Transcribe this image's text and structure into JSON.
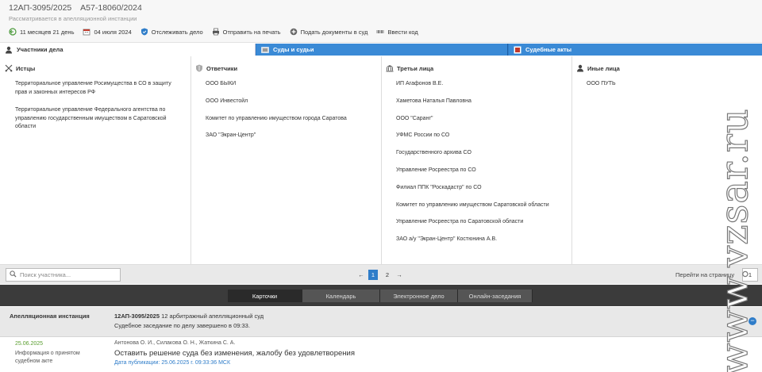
{
  "header": {
    "case_number": "12АП-3095/2025",
    "first_instance_number": "А57-18060/2024",
    "status": "Рассматривается в апелляционной инстанции",
    "toolbar": [
      {
        "icon": "clock-back-icon",
        "label": "11 месяцев 21 день"
      },
      {
        "icon": "calendar-icon",
        "label": "04 июля 2024"
      },
      {
        "icon": "shield-icon",
        "label": "Отслеживать дело"
      },
      {
        "icon": "printer-icon",
        "label": "Отправить на печать"
      },
      {
        "icon": "plus-circle-icon",
        "label": "Подать документы в суд"
      },
      {
        "icon": "barcode-icon",
        "label": "Ввести код"
      }
    ]
  },
  "tabs": [
    {
      "icon": "person-icon",
      "label": "Участники дела",
      "active": true
    },
    {
      "icon": "courthouse-icon",
      "label": "Суды и судьи",
      "active": false
    },
    {
      "icon": "pdf-icon",
      "label": "Судебные акты",
      "active": false
    }
  ],
  "participants": {
    "plaintiffs": {
      "title": "Истцы",
      "icon": "crossed-swords-icon",
      "items": [
        "Территориальное управление Росимущества в СО в защиту прав и законных интересов РФ",
        "Территориальное управление Федерального агентства по управлению государственным имуществом в Саратовской области"
      ]
    },
    "defendants": {
      "title": "Ответчики",
      "icon": "shield-icon",
      "items": [
        "ООО БЫКИ",
        "ООО Инвестойл",
        "Комитет по управлению имуществом города Саратова",
        "ЗАО \"Экран-Центр\""
      ]
    },
    "third_parties": {
      "title": "Третьи лица",
      "icon": "building-icon",
      "items": [
        "ИП Агафонов В.Е.",
        "Хаметова Наталья Павловна",
        "ООО \"Саранг\"",
        "УФМС России по СО",
        "Государственного архива СО",
        "Управление Росреестра по СО",
        "Филиал ППК \"Роскадастр\" по СО",
        "Комитет по управлению имуществом Саратовской области",
        "Управление Росреестра по Саратовской области",
        "ЗАО а/у \"Экран-Центр\" Костюнина А.В."
      ]
    },
    "others": {
      "title": "Иные лица",
      "icon": "person-icon",
      "items": [
        "ООО ПУТЬ"
      ]
    }
  },
  "search": {
    "placeholder": "Поиск участника...",
    "pages": [
      "1",
      "2"
    ],
    "current_page": "1",
    "prev_arrow": "←",
    "next_arrow": "→",
    "goto_label": "Перейти на страницу",
    "goto_value": "1"
  },
  "view_tabs": [
    {
      "label": "Карточки",
      "active": true
    },
    {
      "label": "Календарь",
      "active": false
    },
    {
      "label": "Электронное дело",
      "active": false
    },
    {
      "label": "Онлайн-заседания",
      "active": false
    }
  ],
  "instance": {
    "label": "Апелляционная инстанция",
    "case_number": "12АП-3095/2025",
    "court": "12 арбитражный апелляционный суд",
    "status": "Судебное заседание по делу завершено в 09:33.",
    "collapse_symbol": "−"
  },
  "document": {
    "date": "25.06.2025",
    "type": "Информация о принятом судебном акте",
    "judges": "Антонова О. И., Силакова О. Н., Жаткина С. А.",
    "title": "Оставить решение суда без изменения, жалобу без удовлетворения",
    "published": "Дата публикации: 25.06.2025 г. 09:33:36 МСК"
  },
  "watermark": "www.vzsar.ru",
  "colors": {
    "accent": "#2f7dc9",
    "date_green": "#5a9e2f",
    "dark_bar": "#3b3b3b"
  }
}
